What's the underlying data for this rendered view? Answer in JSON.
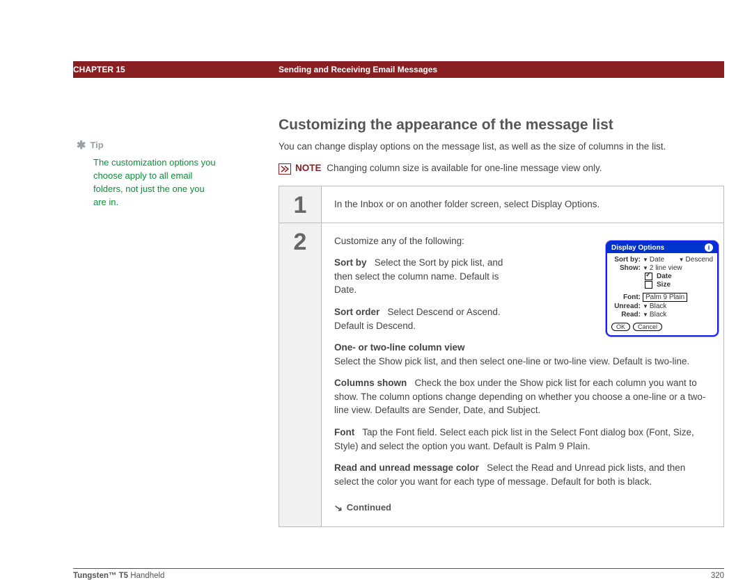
{
  "header": {
    "chapter": "CHAPTER 15",
    "title": "Sending and Receiving Email Messages"
  },
  "tip": {
    "label": "Tip",
    "text": "The customization options you choose apply to all email folders, not just the one you are in."
  },
  "section": {
    "title": "Customizing the appearance of the message list",
    "intro": "You can change display options on the message list, as well as the size of columns in the list.",
    "note_label": "NOTE",
    "note_text": "Changing column size is available for one-line message view only."
  },
  "steps": {
    "s1": {
      "num": "1",
      "text": "In the Inbox or on another folder screen, select Display Options."
    },
    "s2": {
      "num": "2",
      "intro": "Customize any of the following:",
      "sortby_label": "Sort by",
      "sortby_text": "Select the Sort by pick list, and then select the column name. Default is Date.",
      "sortorder_label": "Sort order",
      "sortorder_text": "Select Descend or Ascend. Default is Descend.",
      "columnview_label": "One- or two-line column view",
      "columnview_text": "Select the Show pick list, and then select one-line or two-line view. Default is two-line.",
      "columnsshown_label": "Columns shown",
      "columnsshown_text": "Check the box under the Show pick list for each column you want to show. The column options change depending on whether you choose a one-line or a two-line view. Defaults are Sender, Date, and Subject.",
      "font_label": "Font",
      "font_text": "Tap the Font field. Select each pick list in the Select Font dialog box (Font, Size, Style) and select the option you want. Default is Palm 9 Plain.",
      "readcolor_label": "Read and unread message color",
      "readcolor_text": "Select the Read and Unread pick lists, and then select the color you want for each type of message. Default for both is black.",
      "continued": "Continued"
    }
  },
  "device": {
    "title": "Display Options",
    "sortby_label": "Sort by:",
    "sortby_val": "Date",
    "sortby_order": "Descend",
    "show_label": "Show:",
    "show_val": "2 line view",
    "opt_date": "Date",
    "opt_size": "Size",
    "font_label": "Font:",
    "font_val": "Palm 9 Plain",
    "unread_label": "Unread:",
    "unread_val": "Black",
    "read_label": "Read:",
    "read_val": "Black",
    "ok": "OK",
    "cancel": "Cancel"
  },
  "footer": {
    "product_bold": "Tungsten™ T5",
    "product_rest": " Handheld",
    "page": "320"
  }
}
